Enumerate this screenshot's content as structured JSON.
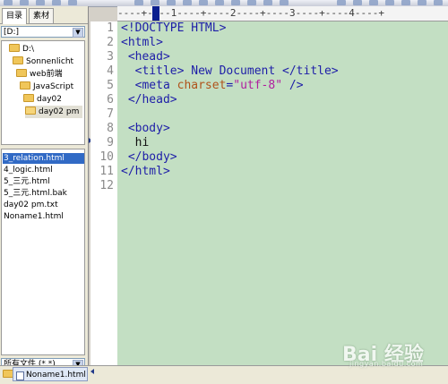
{
  "left_panel": {
    "tabs": [
      {
        "label": "目录",
        "active": true
      },
      {
        "label": "素材",
        "active": false
      }
    ],
    "drive": "[D:]",
    "folders": [
      {
        "label": "D:\\"
      },
      {
        "label": "Sonnenlicht"
      },
      {
        "label": "web前端"
      },
      {
        "label": "JavaScript"
      },
      {
        "label": "day02"
      },
      {
        "label": "day02 pm"
      }
    ],
    "files": [
      {
        "label": "3_relation.html"
      },
      {
        "label": "4_logic.html"
      },
      {
        "label": "5_三元.html"
      },
      {
        "label": "5_三元.html.bak"
      },
      {
        "label": "day02 pm.txt"
      },
      {
        "label": "Noname1.html"
      }
    ],
    "filter": "所有文件 (*.*)"
  },
  "editor": {
    "ruler": "----+----1----+----2----+----3----+----4----+",
    "line_numbers": [
      "1",
      "2",
      "3",
      "4",
      "5",
      "6",
      "7",
      "8",
      "9",
      "10",
      "11",
      "12"
    ],
    "lines": [
      {
        "text": "<!DOCTYPE HTML>"
      },
      {
        "text": "<html>"
      },
      {
        "text": " <head>"
      },
      {
        "text": "  <title> New Document </title>"
      },
      {
        "meta_open": "  <meta ",
        "attr": "charset",
        "eq": "=",
        "value": "\"utf-8\"",
        "close": " />"
      },
      {
        "text": " </head>"
      },
      {
        "text": ""
      },
      {
        "text": " <body>"
      },
      {
        "text": "  hi"
      },
      {
        "text": " </body>"
      },
      {
        "text": "</html>"
      },
      {
        "text": ""
      }
    ]
  },
  "bottom": {
    "doc_tab": "Noname1.html"
  },
  "watermark": {
    "text": "Bai 经验",
    "sub": "jingyan.baidu.com"
  },
  "colors": {
    "editor_bg": "#c3dfc3",
    "tag": "#1e1ea8",
    "attr": "#b0531b",
    "string": "#b0209f",
    "selection": "#316ac5"
  }
}
